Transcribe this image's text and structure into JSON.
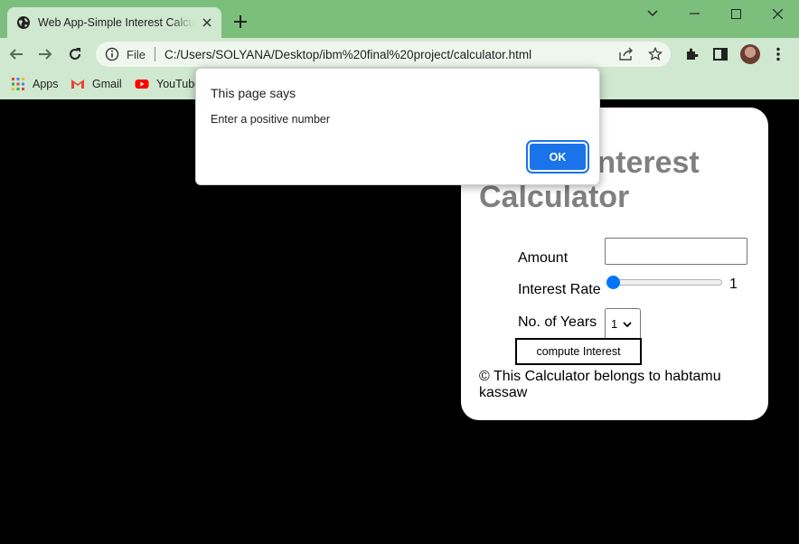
{
  "browser": {
    "tab": {
      "title": "Web App-Simple Interest Calculator"
    },
    "address_bar": {
      "scheme_label": "File",
      "url": "C:/Users/SOLYANA/Desktop/ibm%20final%20project/calculator.html"
    },
    "bookmarks": [
      {
        "label": "Apps",
        "icon": "apps-grid-icon"
      },
      {
        "label": "Gmail",
        "icon": "gmail-icon"
      },
      {
        "label": "YouTube",
        "icon": "youtube-icon"
      }
    ],
    "colors": {
      "frame": "#7cbf7c",
      "toolbar": "#cfe8cf"
    }
  },
  "calculator": {
    "heading": "Simple Interest Calculator",
    "amount": {
      "label": "Amount",
      "value": ""
    },
    "interest_rate": {
      "label": "Interest Rate",
      "value": "1",
      "slider_fraction": 0
    },
    "years": {
      "label": "No. of Years",
      "selected": "1"
    },
    "compute_button": "compute Interest",
    "footer": "© This Calculator belongs to habtamu kassaw"
  },
  "dialog": {
    "title": "This page says",
    "message": "Enter a positive number",
    "ok_button": "OK",
    "accent_color": "#1a73e8"
  }
}
